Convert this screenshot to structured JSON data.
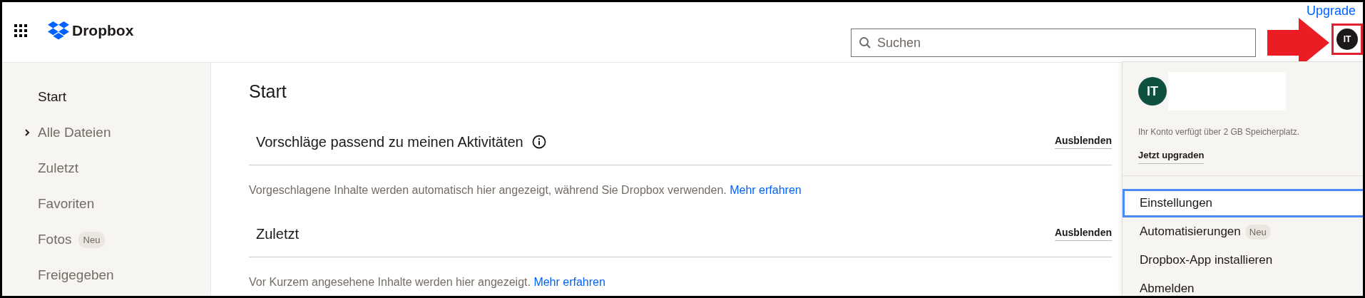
{
  "header": {
    "logo": "Dropbox",
    "search": {
      "placeholder": "Suchen"
    },
    "upgrade_link": "Upgrade",
    "avatar": {
      "initials": "IT"
    }
  },
  "sidebar": {
    "items": [
      {
        "label": "Start",
        "selected": true,
        "expandable": false
      },
      {
        "label": "Alle Dateien",
        "selected": false,
        "expandable": true
      },
      {
        "label": "Zuletzt",
        "selected": false,
        "expandable": false
      },
      {
        "label": "Favoriten",
        "selected": false,
        "expandable": false
      },
      {
        "label": "Fotos",
        "badge": "Neu",
        "selected": false,
        "expandable": false
      },
      {
        "label": "Freigegeben",
        "selected": false,
        "expandable": false
      }
    ]
  },
  "main": {
    "title": "Start",
    "sections": [
      {
        "heading": "Vorschläge passend zu meinen Aktivitäten",
        "info": true,
        "action": "Ausblenden",
        "description": "Vorgeschlagene Inhalte werden automatisch hier angezeigt, während Sie Dropbox verwenden.",
        "link": "Mehr erfahren"
      },
      {
        "heading": "Zuletzt",
        "info": false,
        "action": "Ausblenden",
        "description": "Vor Kurzem angesehene Inhalte werden hier angezeigt.",
        "link": "Mehr erfahren"
      }
    ]
  },
  "account_menu": {
    "avatar": {
      "initials": "IT"
    },
    "storage_note": "Ihr Konto verfügt über 2 GB Speicherplatz.",
    "upgrade_action": "Jetzt upgraden",
    "items": [
      {
        "label": "Einstellungen",
        "selected": true
      },
      {
        "label": "Automatisierungen",
        "badge": "Neu",
        "selected": false
      },
      {
        "label": "Dropbox-App installieren",
        "selected": false
      },
      {
        "label": "Abmelden",
        "selected": false
      }
    ]
  }
}
